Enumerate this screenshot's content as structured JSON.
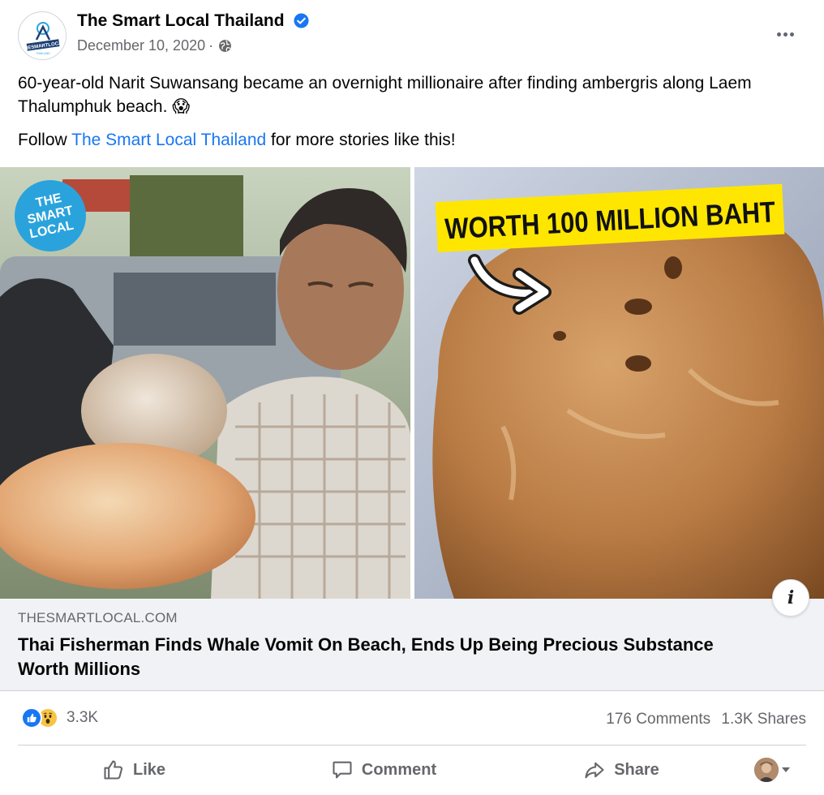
{
  "post": {
    "page_name": "The Smart Local Thailand",
    "date": "December 10, 2020",
    "separator": "·",
    "verified_icon": "verified-badge-icon",
    "audience_icon": "globe-icon",
    "text_line1": "60-year-old Narit Suwansang became an overnight millionaire after finding ambergris along Laem Thalumphuk beach. 😱",
    "follow_prefix": "Follow ",
    "follow_link": "The Smart Local Thailand",
    "follow_suffix": " for more stories like this!"
  },
  "media": {
    "logo_line1": "THE",
    "logo_line2": "SMART",
    "logo_line3": "LOCAL",
    "banner": "WORTH 100 MILLION BAHT",
    "avatar_logo_text": "THESMARTLOCAL",
    "avatar_logo_sub": "THAILAND"
  },
  "link_card": {
    "domain": "THESMARTLOCAL.COM",
    "headline": "Thai Fisherman Finds Whale Vomit On Beach, Ends Up Being Precious Substance Worth Millions",
    "info_label": "i"
  },
  "stats": {
    "reactions": [
      "like",
      "wow"
    ],
    "reaction_count": "3.3K",
    "comments": "176 Comments",
    "shares": "1.3K Shares"
  },
  "actions": {
    "like": "Like",
    "comment": "Comment",
    "share": "Share"
  },
  "colors": {
    "facebook_blue": "#1877f2",
    "secondary_text": "#65676b",
    "banner_yellow": "#ffe600",
    "logo_blue": "#2aa3dc"
  }
}
